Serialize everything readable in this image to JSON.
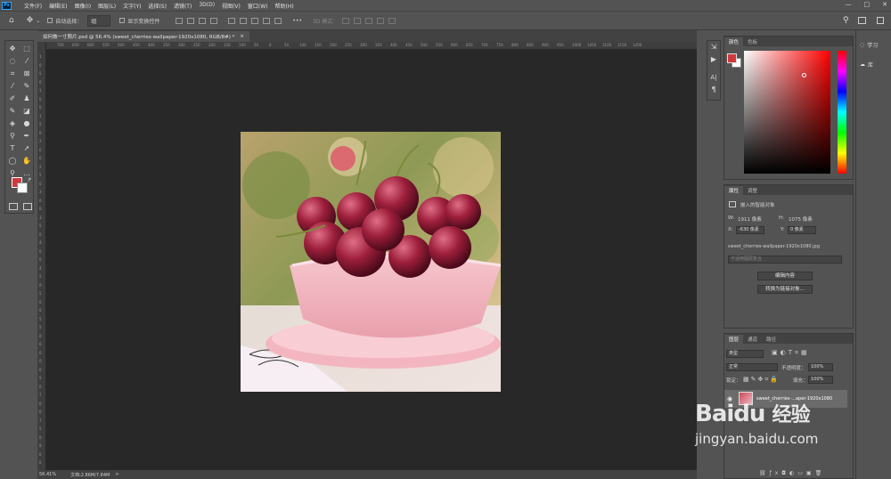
{
  "app": {
    "logo": "Ps"
  },
  "menu": [
    "文件(F)",
    "编辑(E)",
    "图像(I)",
    "图层(L)",
    "文字(Y)",
    "选择(S)",
    "滤镜(T)",
    "3D(D)",
    "视图(V)",
    "窗口(W)",
    "帮助(H)"
  ],
  "window_controls": {
    "minimize": "—",
    "maximize": "□",
    "close": "✕"
  },
  "options": {
    "auto_select_label": "自动选择：",
    "auto_select_value": "组",
    "show_transform_label": "显示变换控件",
    "mode_label": "3D 模式：",
    "more": "•••"
  },
  "document_tab": {
    "title": "如何做一寸照片.psd @ 56.4% (sweet_cherries-wallpaper-1920x1080, RGB/8#) *",
    "close": "×"
  },
  "ruler_top_ticks": [
    "700",
    "650",
    "600",
    "550",
    "500",
    "450",
    "400",
    "350",
    "300",
    "250",
    "200",
    "150",
    "100",
    "50",
    "0",
    "50",
    "100",
    "150",
    "200",
    "250",
    "300",
    "350",
    "400",
    "450",
    "500",
    "550",
    "600",
    "650",
    "700",
    "750",
    "800",
    "850",
    "900",
    "950",
    "1000",
    "1050",
    "1100",
    "1150",
    "1200"
  ],
  "ruler_left_ticks": [
    "1",
    "0",
    "5",
    "0",
    "1",
    "0",
    "0",
    "1",
    "5",
    "0",
    "2",
    "0",
    "0",
    "2",
    "5",
    "0",
    "3",
    "0",
    "0",
    "3",
    "5",
    "0",
    "4",
    "0",
    "0",
    "4",
    "5",
    "0",
    "5",
    "0",
    "0",
    "5",
    "5",
    "0",
    "6",
    "0",
    "0",
    "6",
    "5",
    "0",
    "7",
    "0",
    "0",
    "7",
    "5",
    "0",
    "8",
    "0",
    "0"
  ],
  "status": {
    "zoom": "56.41%",
    "doc_info": "文档:2.86M/7.84M",
    "arrow": ">"
  },
  "color_panel": {
    "tabs": [
      "颜色",
      "色板"
    ],
    "fg_color": "#d0393c",
    "bg_color": "#ffffff"
  },
  "properties_panel": {
    "tabs": [
      "属性",
      "调整"
    ],
    "object_type": "嵌入的智能对象",
    "w_label": "W:",
    "w_value": "1911 像素",
    "h_label": "H:",
    "h_value": "1075 像素",
    "x_label": "X:",
    "x_value": "-630 像素",
    "y_label": "Y:",
    "y_value": "0 像素",
    "filename": "sweet_cherries-wallpaper-1920x1080.jpg",
    "layer_comp_placeholder": "不适用图层复合",
    "edit_button": "编辑内容",
    "convert_button": "转换为链接对象..."
  },
  "layers_panel": {
    "tabs": [
      "图层",
      "通道",
      "路径"
    ],
    "filter_label": "类型",
    "blend_mode": "正常",
    "opacity_label": "不透明度：",
    "opacity_value": "100%",
    "lock_label": "锁定：",
    "fill_label": "填充：",
    "fill_value": "100%",
    "layer_name": "sweet_cherries-...aper-1920x1080"
  },
  "right_strip": {
    "learn": "学习",
    "library": "库"
  },
  "watermark": {
    "brand": "Bai",
    "paw": "du",
    "jingyan": "经验",
    "url": "jingyan.baidu.com"
  }
}
